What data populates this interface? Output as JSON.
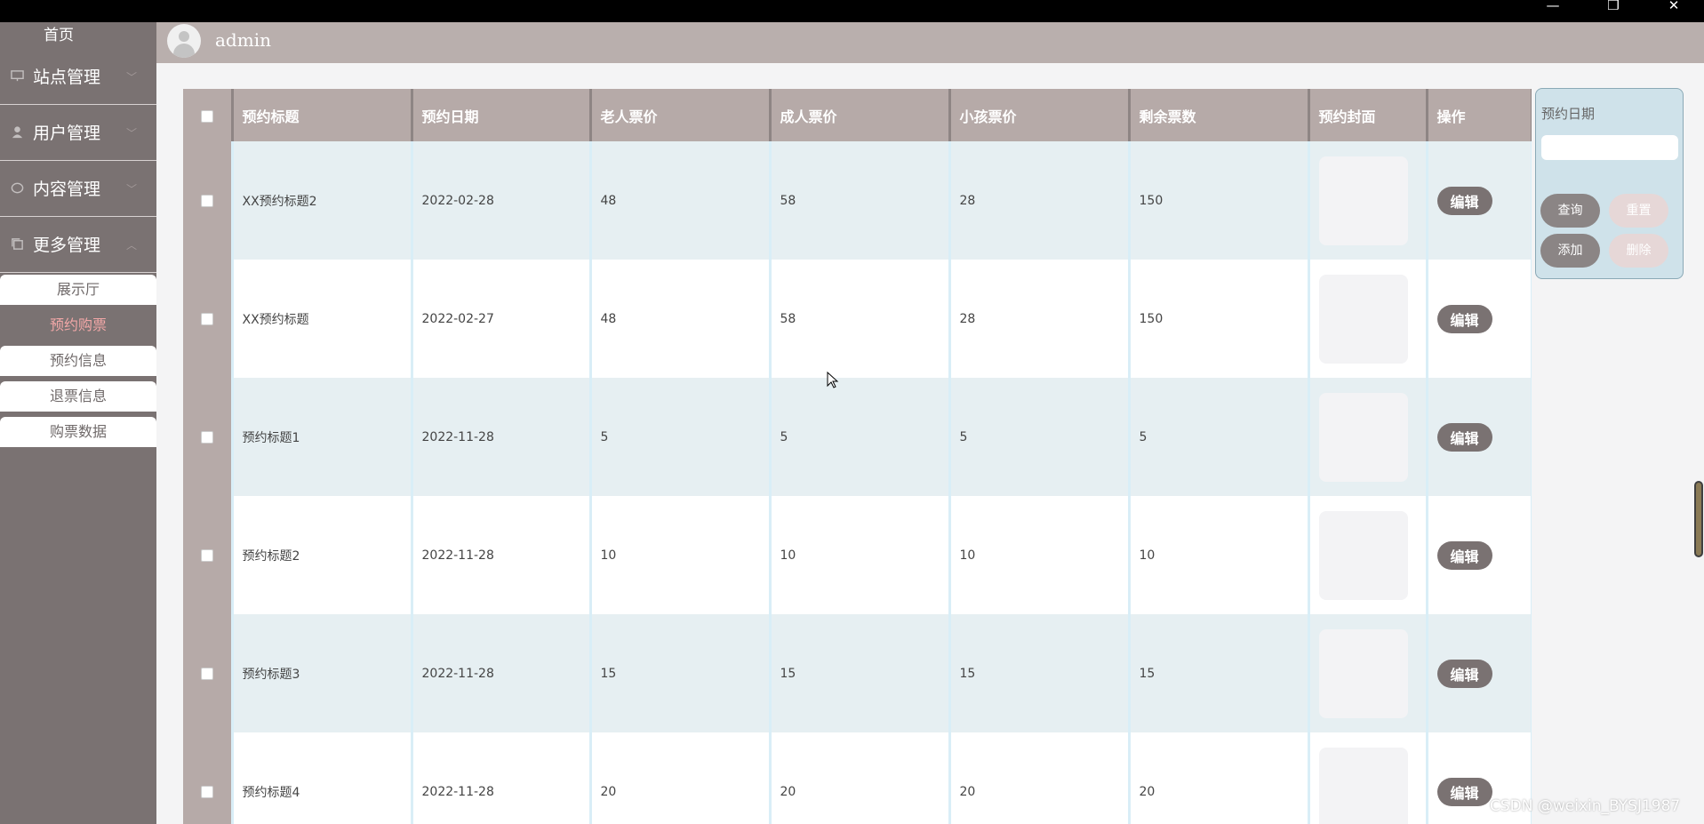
{
  "window": {
    "minimize": "—",
    "restore": "❐",
    "close": "✕"
  },
  "sidebar": {
    "home": "首页",
    "menus": [
      {
        "label": "站点管理",
        "icon": "monitor-icon",
        "chevron": "﹀"
      },
      {
        "label": "用户管理",
        "icon": "user-icon",
        "chevron": "﹀"
      },
      {
        "label": "内容管理",
        "icon": "chat-icon",
        "chevron": "﹀"
      },
      {
        "label": "更多管理",
        "icon": "copy-icon",
        "chevron": "︿"
      }
    ],
    "submenu": [
      "展示厅",
      "预约购票",
      "预约信息",
      "退票信息",
      "购票数据"
    ],
    "active_submenu": "预约购票"
  },
  "header": {
    "username": "admin"
  },
  "table": {
    "columns": [
      "预约标题",
      "预约日期",
      "老人票价",
      "成人票价",
      "小孩票价",
      "剩余票数",
      "预约封面",
      "操作"
    ],
    "edit_label": "编辑",
    "rows": [
      {
        "title": "XX预约标题2",
        "date": "2022-02-28",
        "elder": "48",
        "adult": "58",
        "child": "28",
        "remaining": "150"
      },
      {
        "title": "XX预约标题",
        "date": "2022-02-27",
        "elder": "48",
        "adult": "58",
        "child": "28",
        "remaining": "150"
      },
      {
        "title": "预约标题1",
        "date": "2022-11-28",
        "elder": "5",
        "adult": "5",
        "child": "5",
        "remaining": "5"
      },
      {
        "title": "预约标题2",
        "date": "2022-11-28",
        "elder": "10",
        "adult": "10",
        "child": "10",
        "remaining": "10"
      },
      {
        "title": "预约标题3",
        "date": "2022-11-28",
        "elder": "15",
        "adult": "15",
        "child": "15",
        "remaining": "15"
      },
      {
        "title": "预约标题4",
        "date": "2022-11-28",
        "elder": "20",
        "adult": "20",
        "child": "20",
        "remaining": "20"
      }
    ]
  },
  "search_panel": {
    "label": "预约日期",
    "input_value": "",
    "query": "查询",
    "reset": "重置",
    "add": "添加",
    "delete": "删除"
  },
  "watermark": "CSDN @weixin_BYSJ1987"
}
